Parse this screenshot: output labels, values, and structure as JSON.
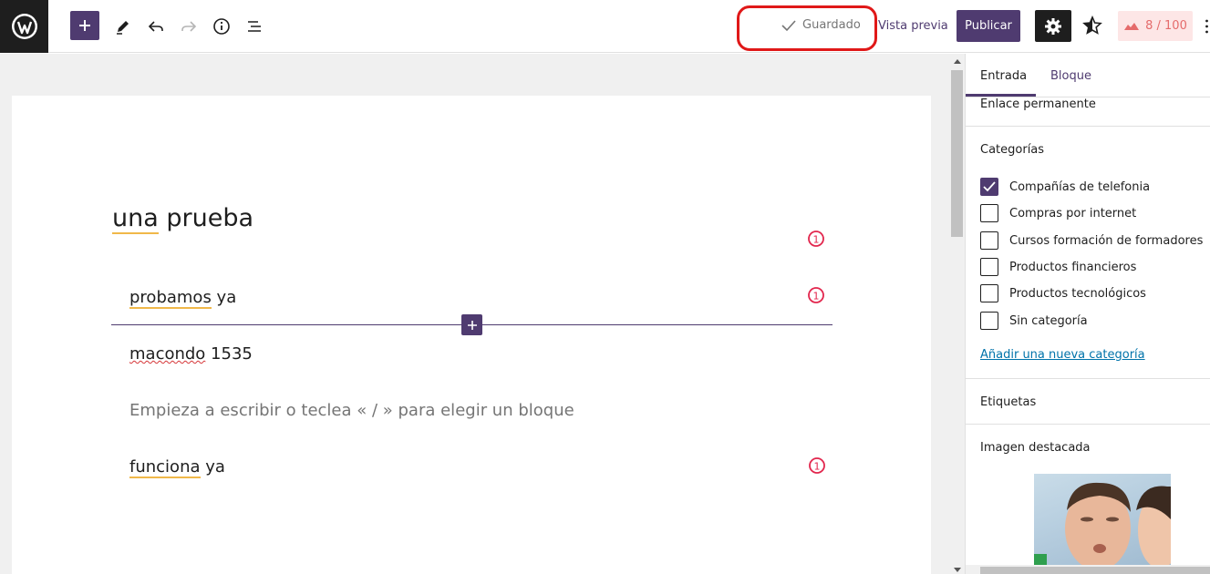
{
  "toolbar": {
    "saved_label": "Guardado",
    "preview_label": "Vista previa",
    "publish_label": "Publicar",
    "score_label": "8 / 100"
  },
  "editor": {
    "post_title": "una prueba",
    "paragraphs": [
      {
        "underlined": "probamos",
        "rest": " ya",
        "has_issue": true
      },
      {
        "underlined": "macondo",
        "rest": " 1535",
        "has_issue": false
      },
      {
        "placeholder": "Empieza a escribir o teclea « / » para elegir un bloque"
      },
      {
        "underlined": "funciona",
        "rest": " ya",
        "has_issue": true
      }
    ]
  },
  "sidebar": {
    "tabs": [
      "Entrada",
      "Bloque"
    ],
    "active_tab": "Entrada",
    "permalink_label": "Enlace permanente",
    "categories_title": "Categorías",
    "categories": [
      {
        "label": "Compañías de telefonia",
        "checked": true
      },
      {
        "label": "Compras por internet",
        "checked": false
      },
      {
        "label": "Cursos formación de formadores",
        "checked": false
      },
      {
        "label": "Productos financieros",
        "checked": false
      },
      {
        "label": "Productos tecnológicos",
        "checked": false
      },
      {
        "label": "Sin categoría",
        "checked": false
      }
    ],
    "add_category_label": "Añadir una nueva categoría",
    "tags_title": "Etiquetas",
    "featured_image_title": "Imagen destacada"
  },
  "colors": {
    "accent": "#4f3b70",
    "highlight_outline": "#e01818",
    "issue": "#e2264d"
  },
  "icons": [
    "wordpress-logo-icon",
    "plus-icon",
    "pencil-icon",
    "undo-icon",
    "redo-icon",
    "info-icon",
    "list-view-icon",
    "check-icon",
    "gear-icon",
    "star-icon",
    "score-icon",
    "issue-icon"
  ]
}
